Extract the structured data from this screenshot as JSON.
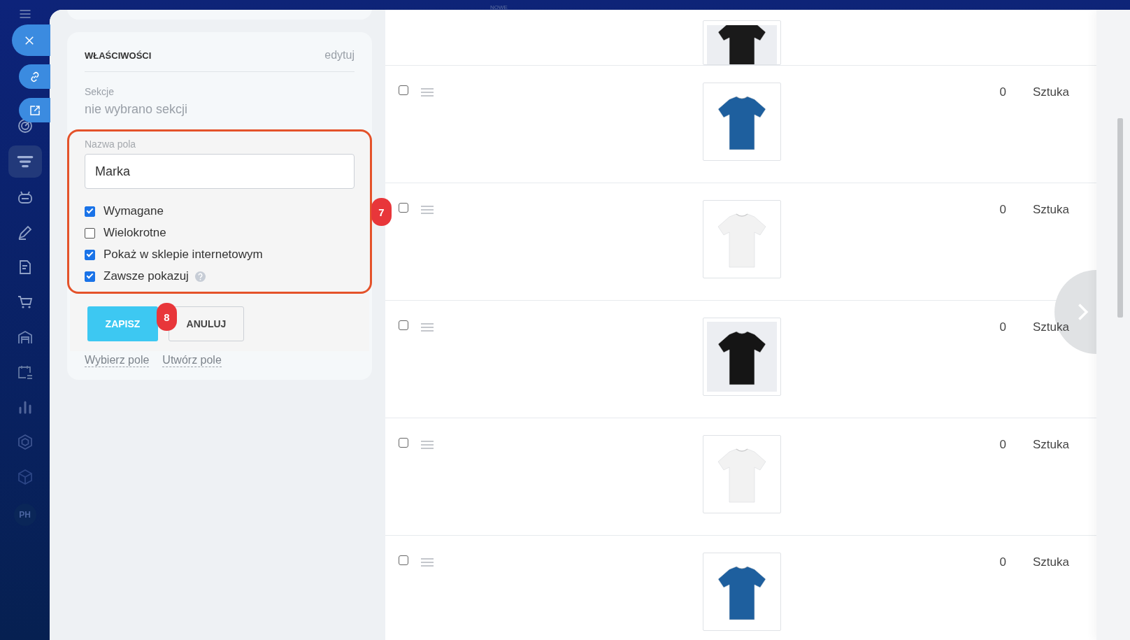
{
  "top_bar": {
    "label": "NOWE"
  },
  "sidebar": {
    "avatar": "PH"
  },
  "properties": {
    "title": "WŁAŚCIWOŚCI",
    "edit_link": "edytuj",
    "sections_label": "Sekcje",
    "sections_value": "nie wybrano sekcji",
    "field_name_label": "Nazwa pola",
    "field_name_value": "Marka",
    "options": [
      {
        "label": "Wymagane",
        "checked": true
      },
      {
        "label": "Wielokrotne",
        "checked": false
      },
      {
        "label": "Pokaż w sklepie internetowym",
        "checked": true
      },
      {
        "label": "Zawsze pokazuj",
        "checked": true,
        "help": true
      }
    ],
    "save_button": "ZAPISZ",
    "cancel_button": "ANULUJ",
    "links": [
      "Wybierz pole",
      "Utwórz pole"
    ]
  },
  "callouts": [
    "7",
    "8"
  ],
  "products": [
    {
      "partial": true
    },
    {
      "partial": false,
      "checked": false,
      "quantity": "0",
      "unit": "Sztuka"
    },
    {
      "partial": false,
      "checked": false,
      "quantity": "0",
      "unit": "Sztuka"
    },
    {
      "partial": false,
      "checked": false,
      "quantity": "0",
      "unit": "Sztuka"
    },
    {
      "partial": false,
      "checked": false,
      "quantity": "0",
      "unit": "Sztuka"
    },
    {
      "partial": false,
      "checked": false,
      "quantity": "0",
      "unit": "Sztuka"
    }
  ]
}
